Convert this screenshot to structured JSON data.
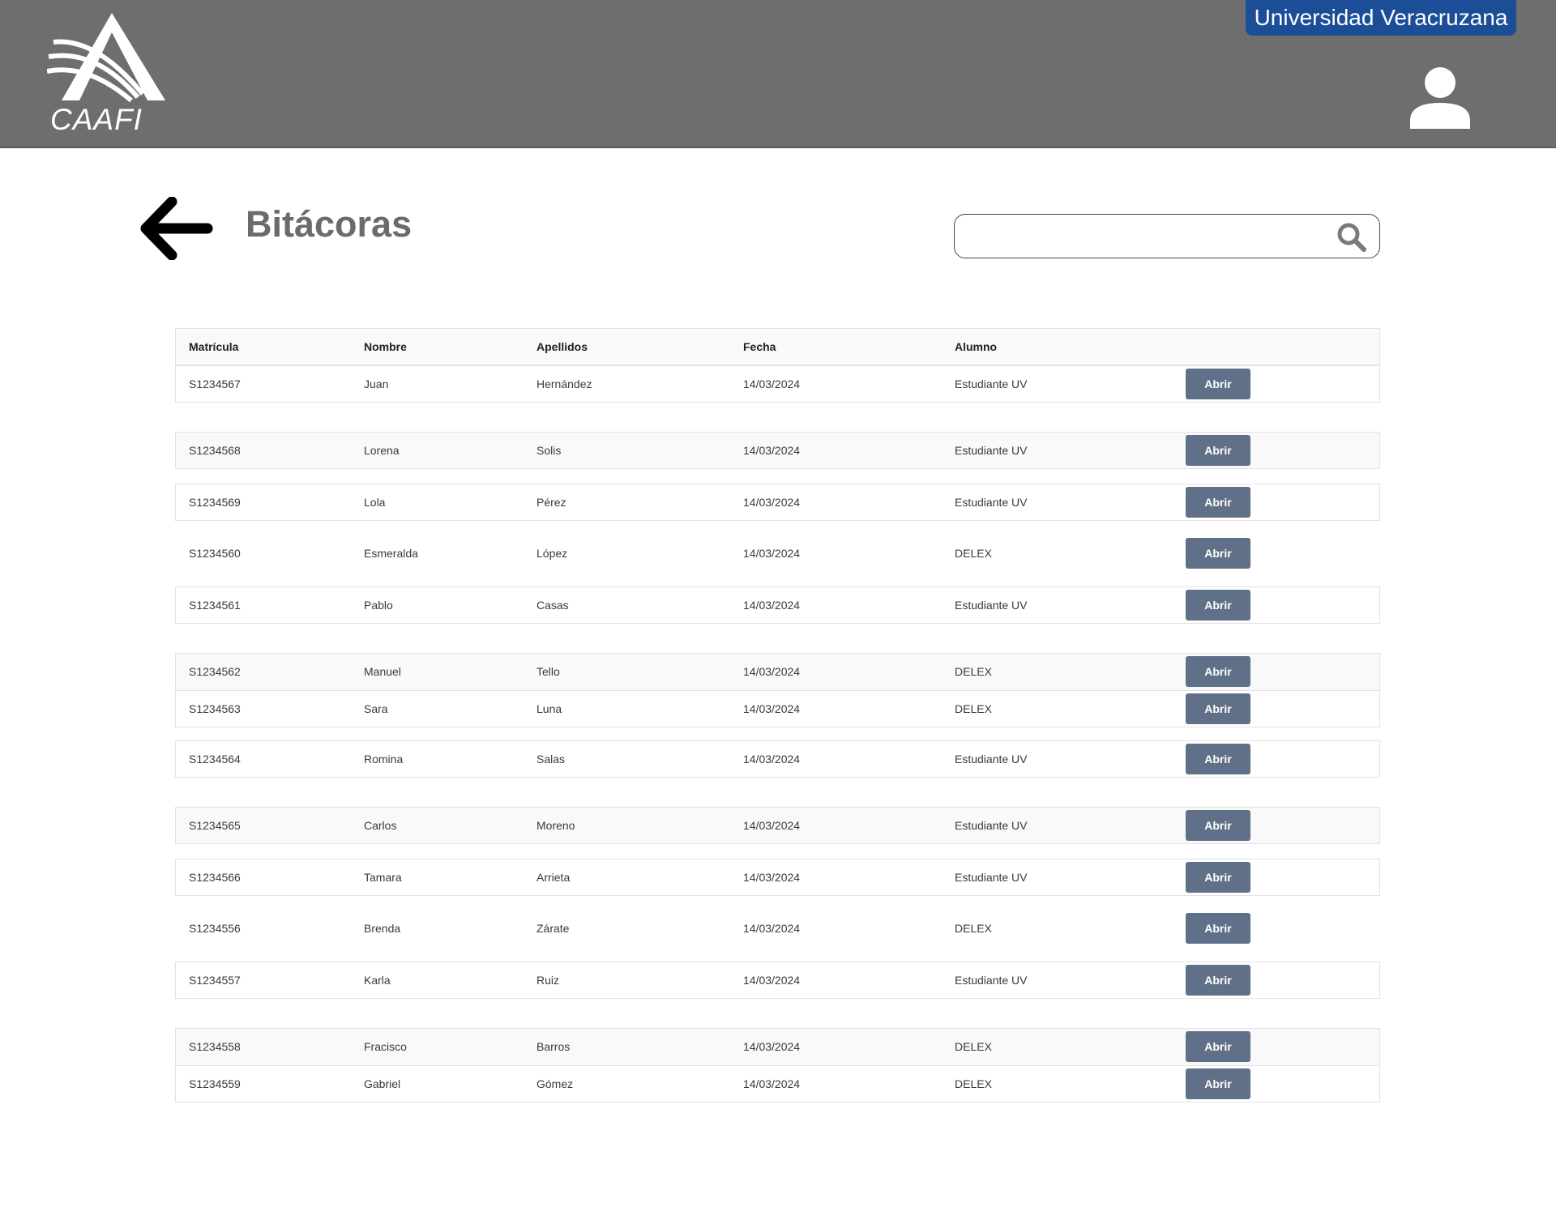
{
  "header": {
    "logo_text": "CAAFI",
    "university": "Universidad Veracruzana"
  },
  "page": {
    "title": "Bitácoras"
  },
  "search": {
    "value": "",
    "placeholder": ""
  },
  "table": {
    "columns": [
      "Matrícula",
      "Nombre",
      "Apellidos",
      "Fecha",
      "Alumno"
    ],
    "action_label": "Abrir",
    "rows": [
      {
        "matricula": "S1234567",
        "nombre": "Juan",
        "apellidos": "Hernández",
        "fecha": "14/03/2024",
        "alumno": "Estudiante UV"
      },
      {
        "matricula": "S1234568",
        "nombre": "Lorena",
        "apellidos": "Solis",
        "fecha": "14/03/2024",
        "alumno": "Estudiante UV"
      },
      {
        "matricula": "S1234569",
        "nombre": "Lola",
        "apellidos": "Pérez",
        "fecha": "14/03/2024",
        "alumno": "Estudiante UV"
      },
      {
        "matricula": "S1234560",
        "nombre": "Esmeralda",
        "apellidos": "López",
        "fecha": "14/03/2024",
        "alumno": "DELEX"
      },
      {
        "matricula": "S1234561",
        "nombre": "Pablo",
        "apellidos": "Casas",
        "fecha": "14/03/2024",
        "alumno": "Estudiante UV"
      },
      {
        "matricula": "S1234562",
        "nombre": "Manuel",
        "apellidos": "Tello",
        "fecha": "14/03/2024",
        "alumno": "DELEX"
      },
      {
        "matricula": "S1234563",
        "nombre": "Sara",
        "apellidos": "Luna",
        "fecha": "14/03/2024",
        "alumno": "DELEX"
      },
      {
        "matricula": "S1234564",
        "nombre": "Romina",
        "apellidos": "Salas",
        "fecha": "14/03/2024",
        "alumno": "Estudiante UV"
      },
      {
        "matricula": "S1234565",
        "nombre": "Carlos",
        "apellidos": "Moreno",
        "fecha": "14/03/2024",
        "alumno": "Estudiante UV"
      },
      {
        "matricula": "S1234566",
        "nombre": "Tamara",
        "apellidos": "Arrieta",
        "fecha": "14/03/2024",
        "alumno": "Estudiante UV"
      },
      {
        "matricula": "S1234556",
        "nombre": "Brenda",
        "apellidos": "Zárate",
        "fecha": "14/03/2024",
        "alumno": "DELEX"
      },
      {
        "matricula": "S1234557",
        "nombre": "Karla",
        "apellidos": "Ruiz",
        "fecha": "14/03/2024",
        "alumno": "Estudiante UV"
      },
      {
        "matricula": "S1234558",
        "nombre": "Fracisco",
        "apellidos": "Barros",
        "fecha": "14/03/2024",
        "alumno": "DELEX"
      },
      {
        "matricula": "S1234559",
        "nombre": "Gabriel",
        "apellidos": "Gómez",
        "fecha": "14/03/2024",
        "alumno": "DELEX"
      }
    ]
  },
  "icons": {
    "logo": "caafi-logo",
    "user": "user-icon",
    "back": "arrow-left-icon",
    "search": "search-icon"
  },
  "colors": {
    "header_bg": "#6e6e6e",
    "university_badge": "#1c4e98",
    "button": "#617089"
  }
}
